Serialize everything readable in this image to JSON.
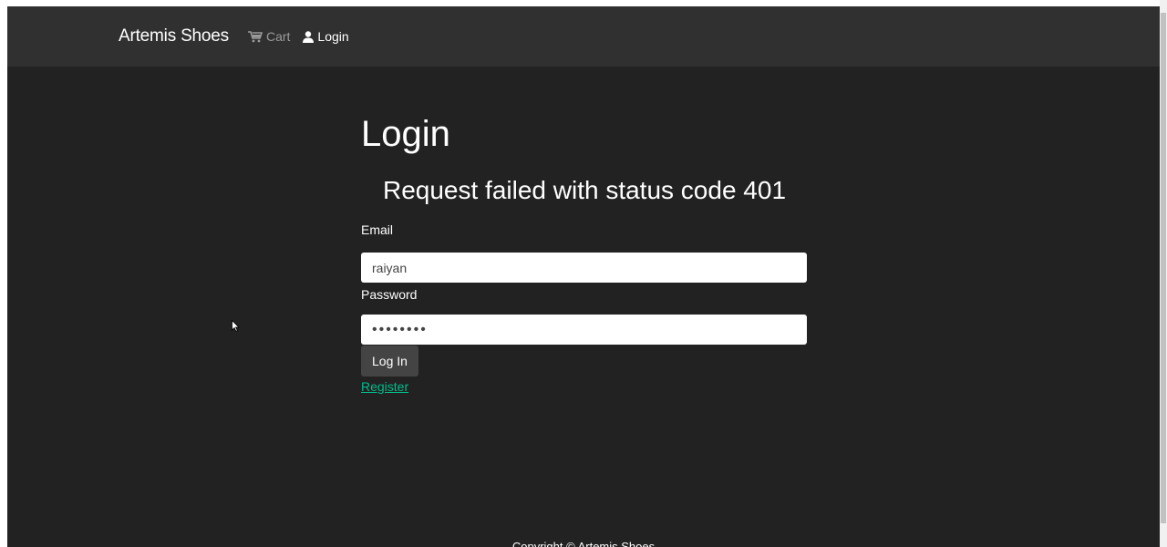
{
  "navbar": {
    "brand": "Artemis Shoes",
    "cart_label": "Cart",
    "login_label": "Login"
  },
  "login_form": {
    "title": "Login",
    "error_message": "Request failed with status code 401",
    "email_label": "Email",
    "email_value": "raiyan",
    "password_label": "Password",
    "password_value": "••••••••",
    "submit_label": "Log In",
    "register_link": "Register"
  },
  "footer": {
    "text": "Copyright © Artemis Shoes"
  },
  "icons": {
    "cart": "cart-icon",
    "user": "user-icon",
    "cursor": "mouse-pointer-icon"
  },
  "colors": {
    "page_background": "#222222",
    "navbar_background": "#303030",
    "link_accent": "#00bc8c",
    "button_background": "#444444"
  }
}
